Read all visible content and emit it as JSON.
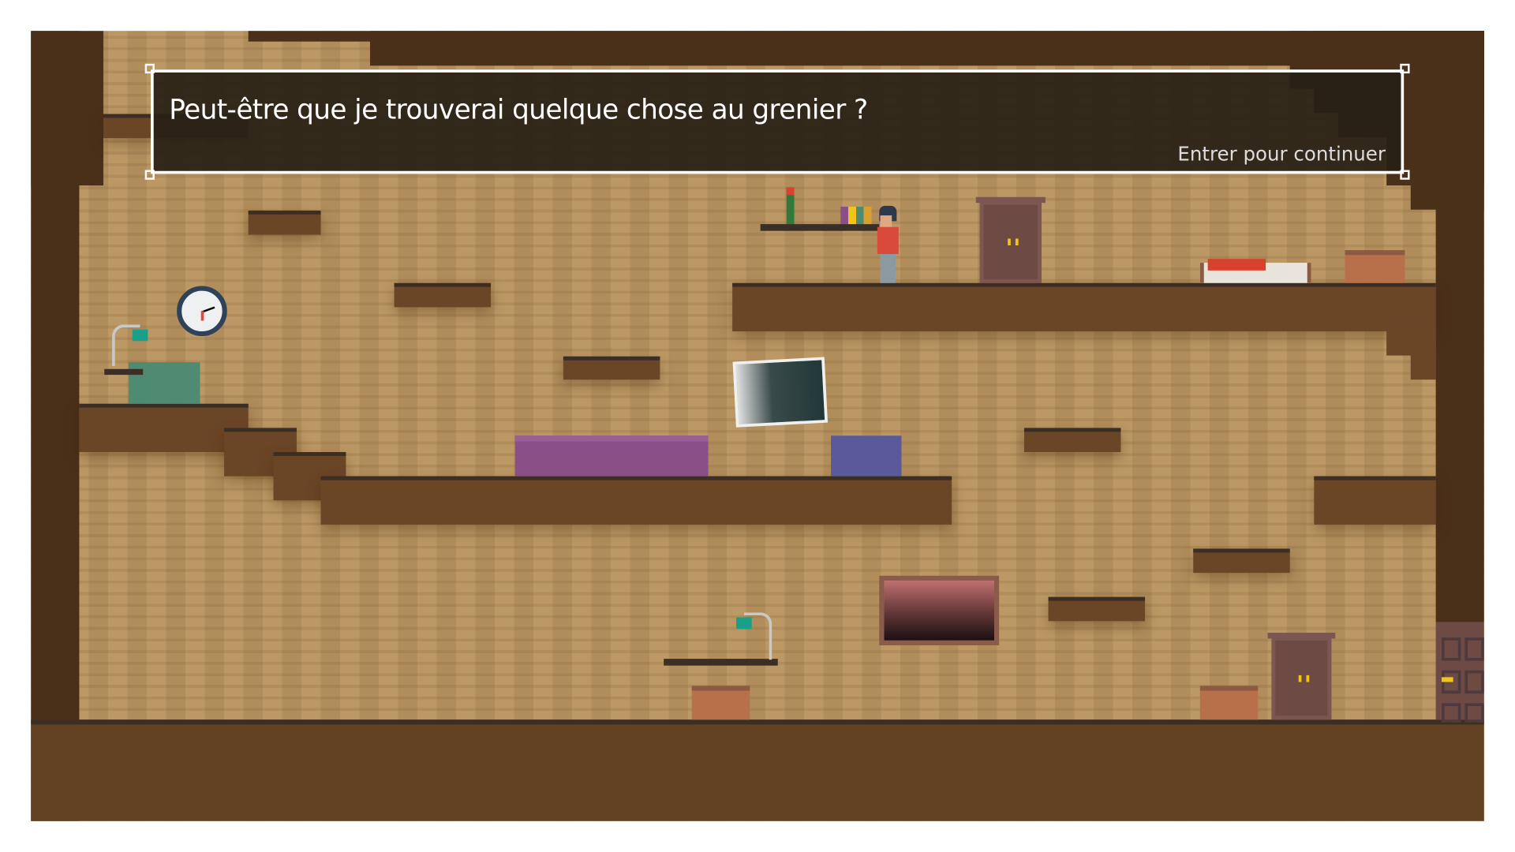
{
  "dialog": {
    "message": "Peut-être que je trouverai quelque chose au grenier ?",
    "hint": "Entrer pour continuer"
  },
  "colors": {
    "wall": "#b8935f",
    "rock": "#4a2f19",
    "platform": "#6a4526",
    "platform_top": "#3a2e25",
    "dialog_bg": "#28201a",
    "dialog_border": "#ffffff",
    "sofa": "#8a4f86",
    "armchair_blue": "#5a5a9a",
    "armchair_green": "#4f8a72",
    "wardrobe": "#6e4a44",
    "knob": "#f0c419"
  },
  "icons": {
    "clock": "clock-icon",
    "door": "door-icon"
  }
}
